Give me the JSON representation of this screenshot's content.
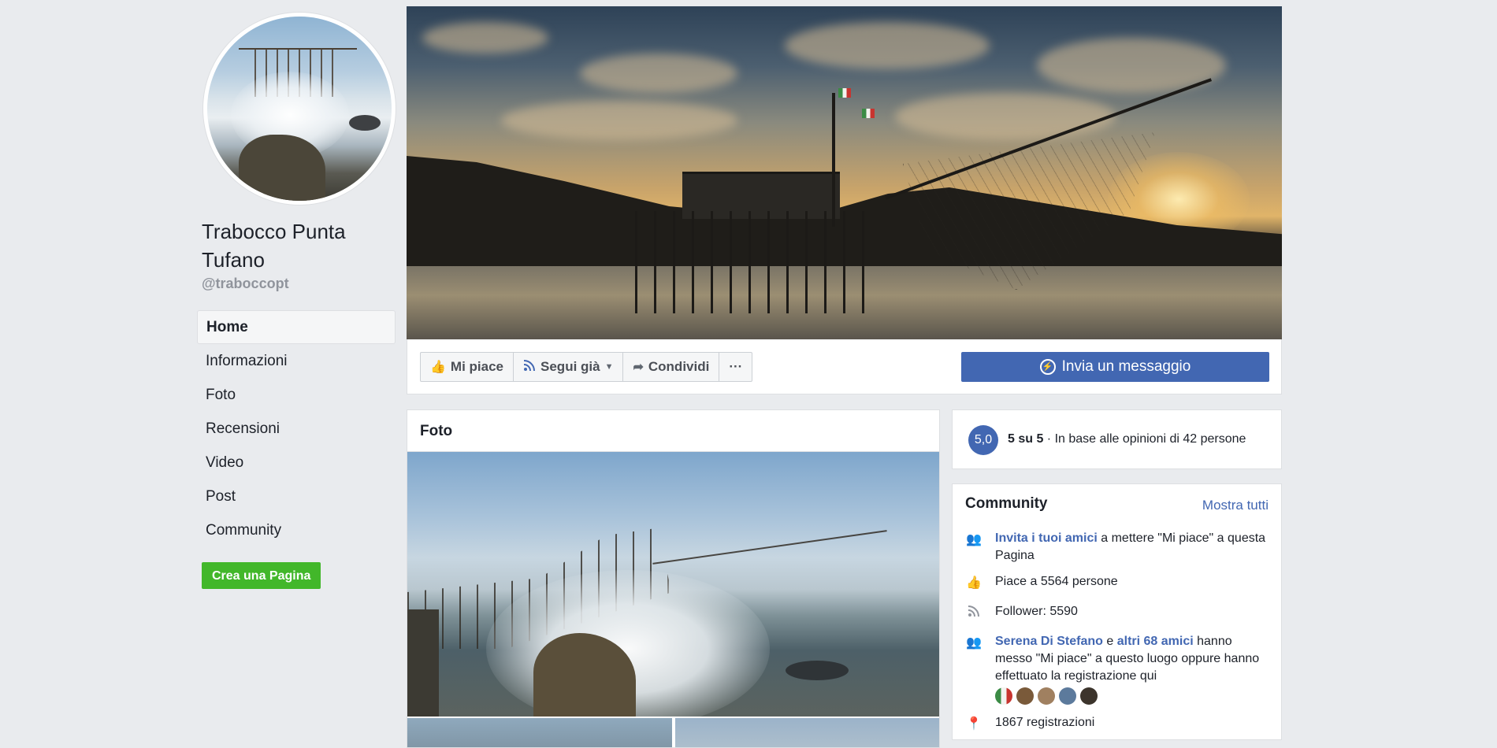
{
  "page": {
    "name": "Trabocco Punta Tufano",
    "handle": "@traboccopt"
  },
  "nav": {
    "items": [
      {
        "label": "Home",
        "active": true
      },
      {
        "label": "Informazioni"
      },
      {
        "label": "Foto"
      },
      {
        "label": "Recensioni"
      },
      {
        "label": "Video"
      },
      {
        "label": "Post"
      },
      {
        "label": "Community"
      }
    ],
    "create_page": "Crea una Pagina"
  },
  "actions": {
    "like": "Mi piace",
    "follow": "Segui già",
    "share": "Condividi",
    "more": "···",
    "message": "Invia un messaggio"
  },
  "photos": {
    "title": "Foto"
  },
  "rating": {
    "score": "5,0",
    "summary_bold": "5 su 5",
    "summary_rest": " · In base alle opinioni di 42 persone"
  },
  "community": {
    "title": "Community",
    "see_all": "Mostra tutti",
    "invite_link": "Invita i tuoi amici",
    "invite_rest": " a mettere \"Mi piace\" a questa Pagina",
    "likes": "Piace a 5564 persone",
    "followers": "Follower: 5590",
    "friend_name": "Serena Di Stefano",
    "friends_and": " e ",
    "friends_more": "altri 68 amici",
    "friends_rest": " hanno messo \"Mi piace\" a questo luogo oppure hanno effettuato la registrazione qui",
    "checkins": "1867 registrazioni"
  },
  "colors": {
    "brand": "#4267b2",
    "green": "#42b72a",
    "background": "#e9ebee"
  }
}
